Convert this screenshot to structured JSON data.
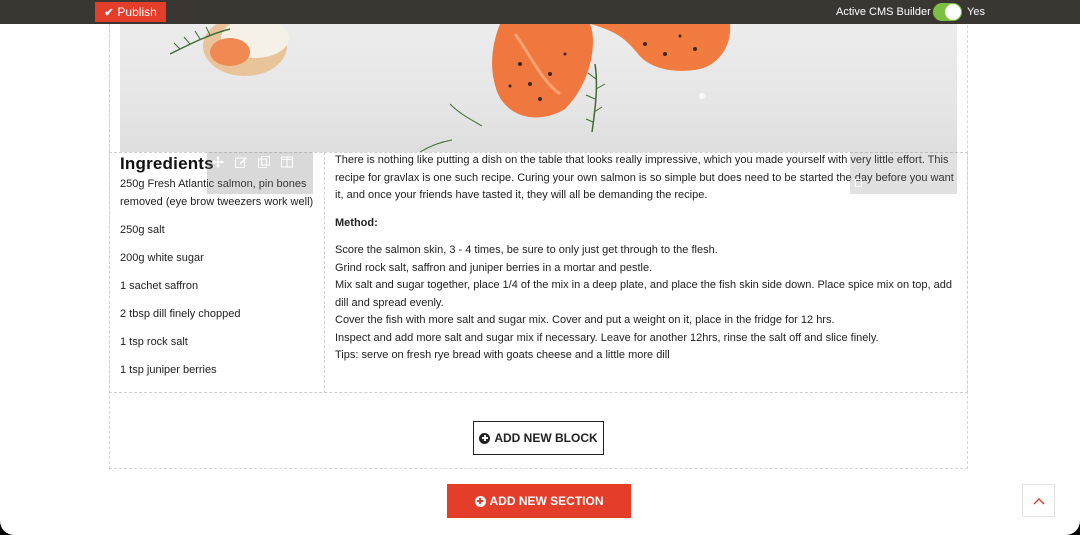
{
  "topbar": {
    "publish_label": "Publish",
    "cms_label": "Active CMS Builder",
    "toggle_value": "Yes",
    "toggle_on": true,
    "accent_color": "#e43e2b",
    "toggle_color": "#7bc043"
  },
  "hero": {
    "icon": "salmon-photo"
  },
  "ingredients": {
    "title": "Ingredients",
    "items": [
      "250g Fresh Atlantic salmon, pin bones removed (eye brow tweezers work well)",
      "250g salt",
      "200g white sugar",
      "1 sachet saffron",
      "2 tbsp dill finely chopped",
      "1 tsp rock salt",
      "1 tsp juniper berries"
    ]
  },
  "recipe": {
    "intro": "There is nothing like putting a dish on the table that looks really impressive, which you made yourself with very little effort. This recipe for gravlax is one such recipe. Curing your own salmon is so simple but does need to be started the day before you want it, and once your friends have tasted it, they will all be demanding the recipe.",
    "method_heading": "Method:",
    "steps": [
      "Score the salmon skin, 3 - 4 times, be sure to only just get through to the flesh.",
      "Grind rock salt, saffron and juniper berries in a mortar and pestle.",
      "Mix salt and sugar together, place 1/4 of the mix in a deep plate, and place the fish skin side down. Place spice mix on top, add dill and spread evenly.",
      "Cover the fish with more salt and sugar mix. Cover and put a weight on it, place in the fridge for 12 hrs.",
      "Inspect and add more salt and sugar mix if necessary. Leave for another 12hrs, rinse the salt off and slice finely.",
      "Tips: serve on fresh rye bread with goats cheese and a little more dill"
    ]
  },
  "actions": {
    "add_block_label": "ADD NEW BLOCK",
    "add_section_label": "ADD NEW SECTION"
  },
  "toolbar_icons": [
    "move-icon",
    "edit-icon",
    "duplicate-icon",
    "columns-icon"
  ]
}
